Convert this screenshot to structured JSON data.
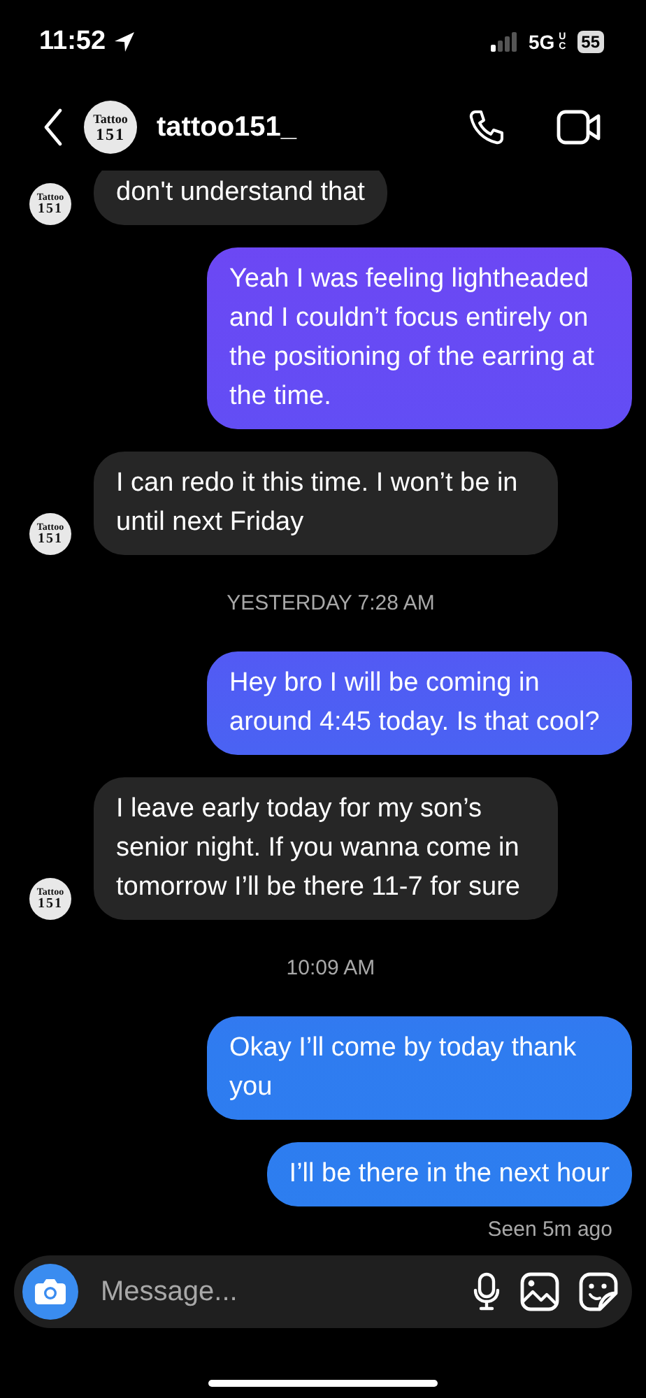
{
  "status_bar": {
    "time": "11:52",
    "network": "5G",
    "network_sub": "UC",
    "battery": "55"
  },
  "header": {
    "avatar": {
      "line_1": "Tattoo",
      "line_2": "151"
    },
    "username": "tattoo151_"
  },
  "messages": [
    {
      "kind": "incoming",
      "text": "don't understand that",
      "avatar": {
        "line_1": "Tattoo",
        "line_2": "151"
      }
    },
    {
      "kind": "outgoing",
      "text": "Yeah I was feeling lightheaded and I couldn’t focus entirely on the positioning of the earring at the time."
    },
    {
      "kind": "incoming",
      "text": "I can redo it this time. I won’t be in until next Friday",
      "avatar": {
        "line_1": "Tattoo",
        "line_2": "151"
      }
    },
    {
      "kind": "timestamp",
      "text": "YESTERDAY 7:28 AM"
    },
    {
      "kind": "outgoing",
      "text": "Hey bro I will be coming in around 4:45 today. Is that cool?"
    },
    {
      "kind": "incoming",
      "text": "I leave early today for my son’s senior night. If you wanna come in tomorrow I’ll be there 11-7 for sure",
      "avatar": {
        "line_1": "Tattoo",
        "line_2": "151"
      }
    },
    {
      "kind": "timestamp",
      "text": "10:09 AM"
    },
    {
      "kind": "outgoing",
      "text": "Okay I’ll come by today thank you"
    },
    {
      "kind": "outgoing",
      "text": "I’ll be there in the next hour"
    },
    {
      "kind": "seen",
      "text": "Seen 5m ago"
    }
  ],
  "composer": {
    "placeholder": "Message..."
  }
}
